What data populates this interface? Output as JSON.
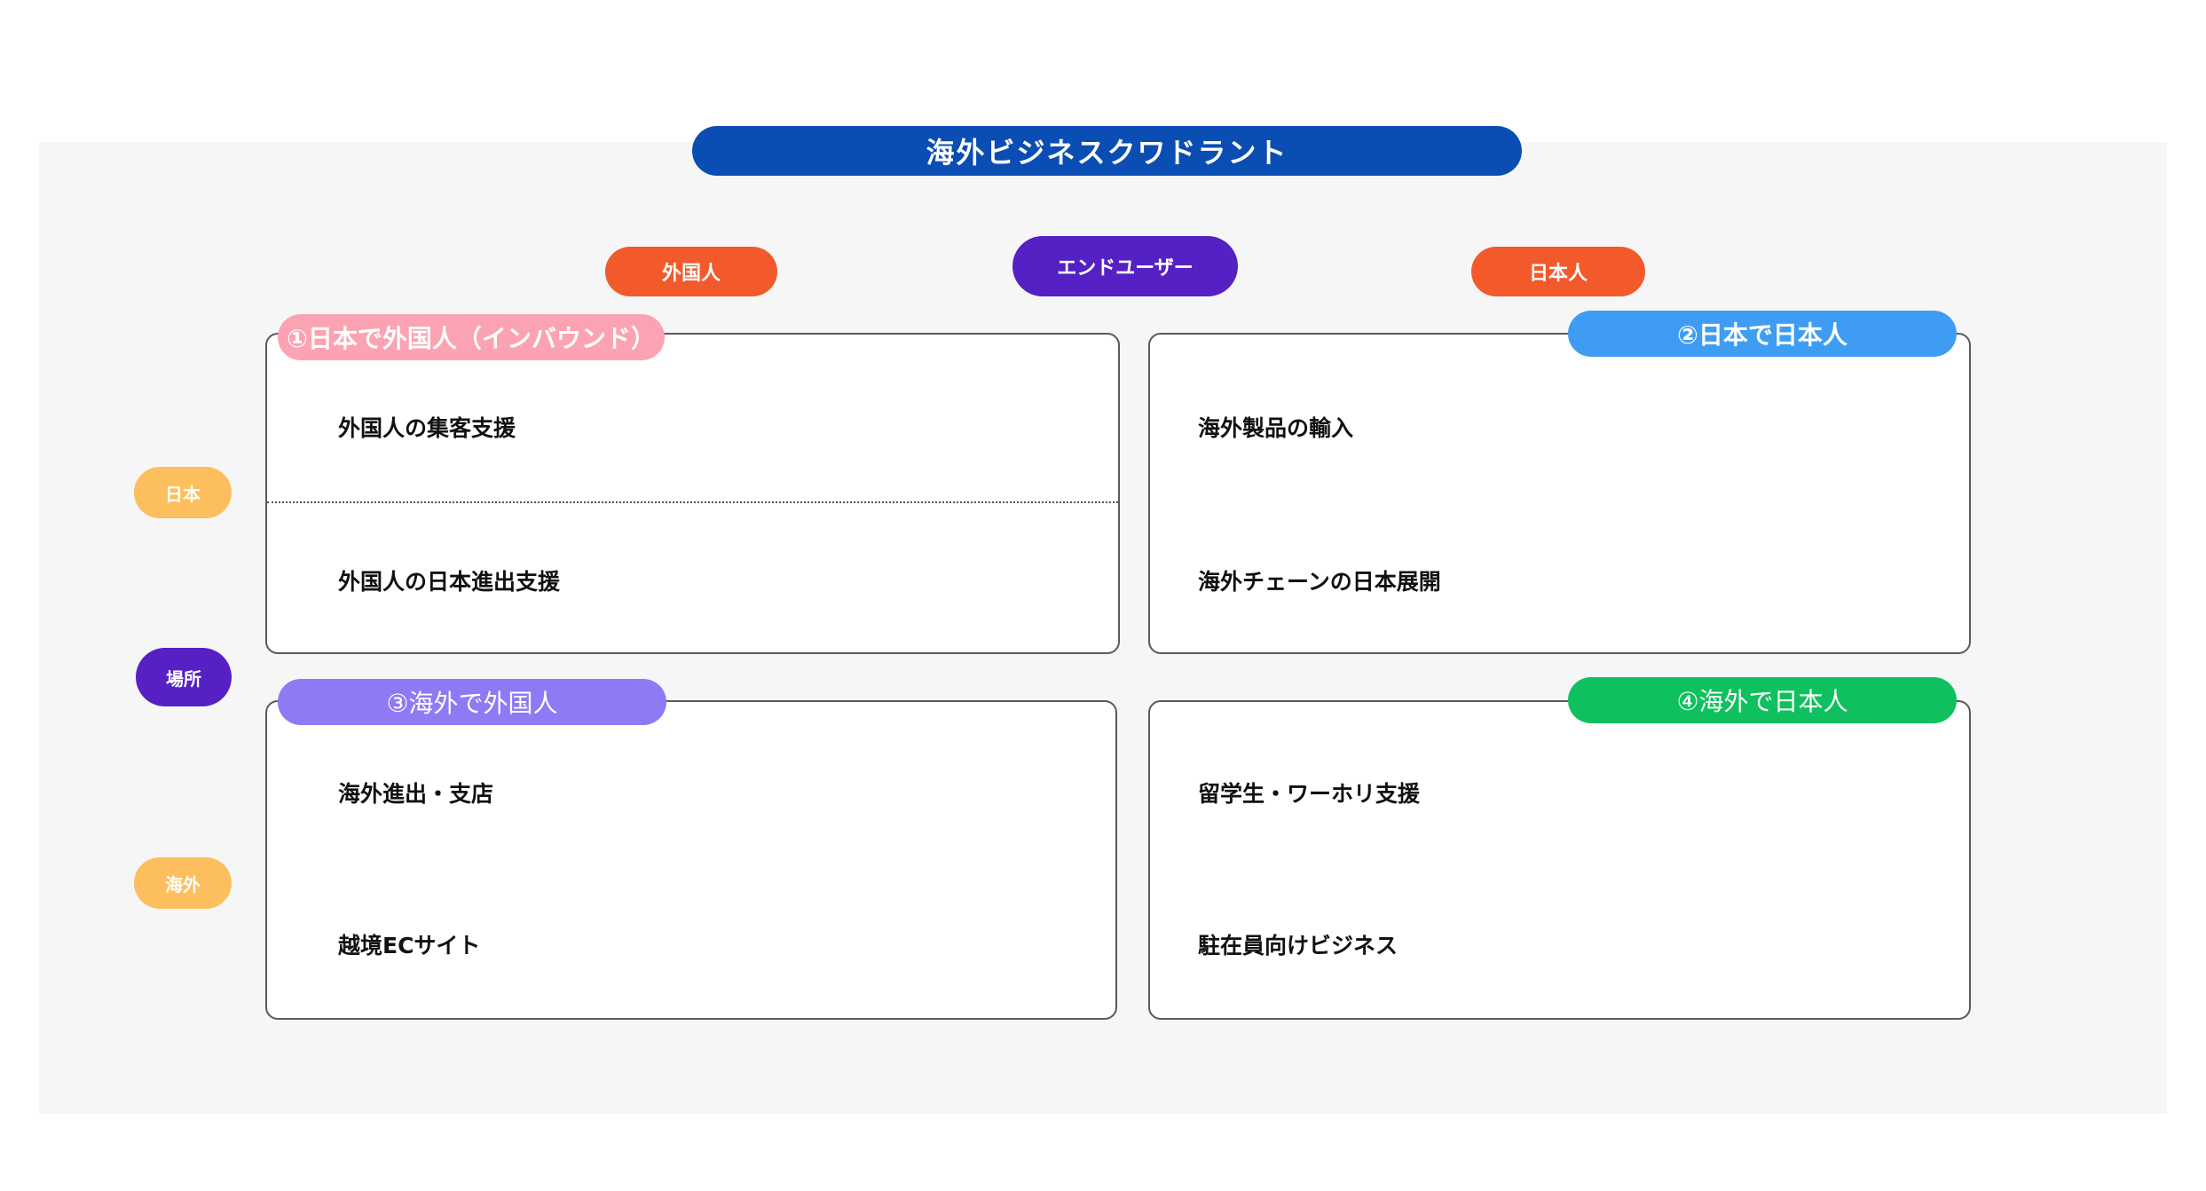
{
  "title": "海外ビジネスクワドラント",
  "top_axis": {
    "left": "外国人",
    "center": "エンドユーザー",
    "right": "日本人"
  },
  "side_axis": {
    "top": "日本",
    "center": "場所",
    "bottom": "海外"
  },
  "quadrants": [
    {
      "label": "①日本で外国人（インバウンド）",
      "color": "#fba3b2",
      "items": [
        "外国人の集客支援",
        "外国人の日本進出支援"
      ]
    },
    {
      "label": "②日本で日本人",
      "color": "#3e9df2",
      "items": [
        "海外製品の輸入",
        "海外チェーンの日本展開"
      ]
    },
    {
      "label": "③海外で外国人",
      "color": "#9079f4",
      "items": [
        "海外進出・支店",
        "越境ECサイト"
      ]
    },
    {
      "label": "④海外で日本人",
      "color": "#0fc15e",
      "items": [
        "留学生・ワーホリ支援",
        "駐在員向けビジネス"
      ]
    }
  ],
  "colors": {
    "title": "#0a4db3",
    "end_user": "#5521c4",
    "customer": "#f25a2c",
    "location": "#fdbf5e"
  }
}
